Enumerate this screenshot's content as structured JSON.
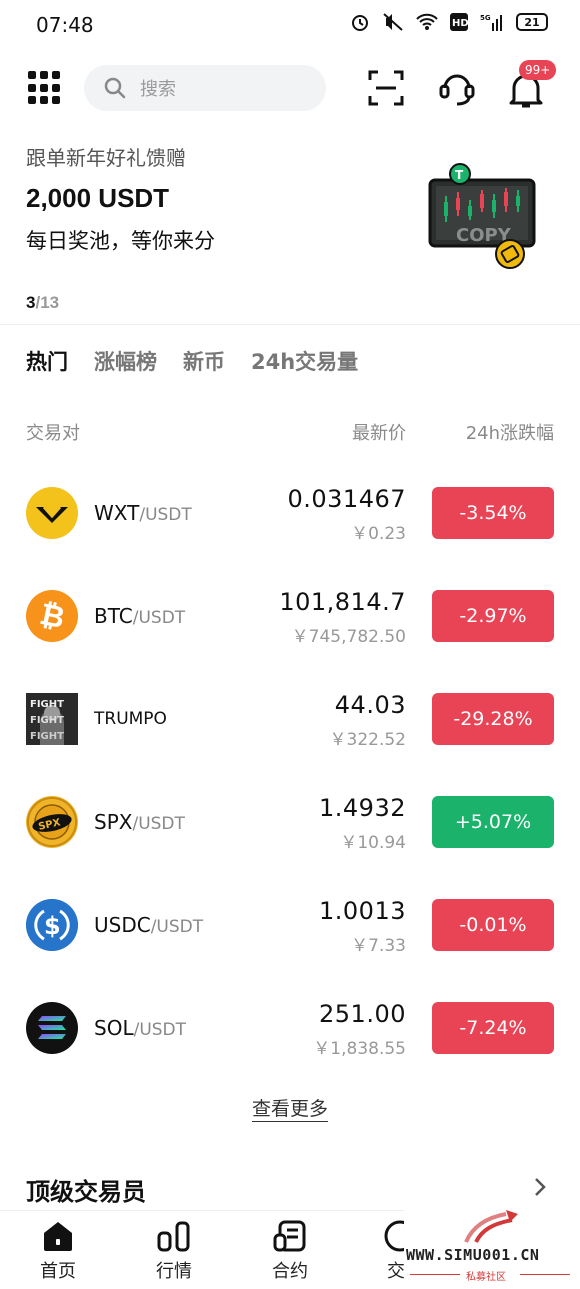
{
  "status_bar": {
    "time": "07:48",
    "battery": "21"
  },
  "search": {
    "placeholder": "搜索"
  },
  "notifications": {
    "badge": "99+"
  },
  "banner": {
    "subtitle": "跟单新年好礼馈赠",
    "title": "2,000 USDT",
    "description": "每日奖池，等你来分",
    "image_text": "COPY",
    "page_current": "3",
    "page_total": "/13"
  },
  "tabs": [
    {
      "label": "热门",
      "active": true
    },
    {
      "label": "涨幅榜",
      "active": false
    },
    {
      "label": "新币",
      "active": false
    },
    {
      "label": "24h交易量",
      "active": false
    }
  ],
  "table_header": {
    "pair": "交易对",
    "price": "最新价",
    "change": "24h涨跌幅"
  },
  "coins": [
    {
      "base": "WXT",
      "quote": "/USDT",
      "price": "0.031467",
      "price_cny": "￥0.23",
      "change": "-3.54%",
      "direction": "down",
      "icon": "wxt-logo-icon"
    },
    {
      "base": "BTC",
      "quote": "/USDT",
      "price": "101,814.7",
      "price_cny": "￥745,782.50",
      "change": "-2.97%",
      "direction": "down",
      "icon": "bitcoin-icon"
    },
    {
      "base": "TRUMPO",
      "quote": "",
      "price": "44.03",
      "price_cny": "￥322.52",
      "change": "-29.28%",
      "direction": "down",
      "icon": "trumpo-image-icon"
    },
    {
      "base": "SPX",
      "quote": "/USDT",
      "price": "1.4932",
      "price_cny": "￥10.94",
      "change": "+5.07%",
      "direction": "up",
      "icon": "spx-logo-icon"
    },
    {
      "base": "USDC",
      "quote": "/USDT",
      "price": "1.0013",
      "price_cny": "￥7.33",
      "change": "-0.01%",
      "direction": "down",
      "icon": "usdc-icon"
    },
    {
      "base": "SOL",
      "quote": "/USDT",
      "price": "251.00",
      "price_cny": "￥1,838.55",
      "change": "-7.24%",
      "direction": "down",
      "icon": "solana-icon"
    }
  ],
  "see_more": "查看更多",
  "section": {
    "title": "顶级交易员"
  },
  "bottom_nav": [
    {
      "label": "首页",
      "icon": "home-icon",
      "active": true
    },
    {
      "label": "行情",
      "icon": "market-icon",
      "active": false
    },
    {
      "label": "合约",
      "icon": "contract-icon",
      "active": false
    },
    {
      "label": "交",
      "icon": "trade-icon",
      "active": false
    }
  ],
  "watermark": {
    "text": "WWW.SIMU001.CN",
    "sub": "私募社区"
  },
  "colors": {
    "down": "#e94456",
    "up": "#1bb26b",
    "accent": "#111111"
  }
}
